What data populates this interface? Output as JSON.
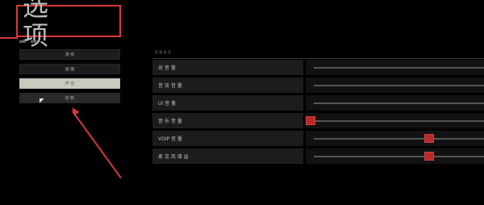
{
  "header": {
    "title": "选 项"
  },
  "menu": {
    "items": [
      {
        "label": "游 戏",
        "state": "normal"
      },
      {
        "label": "画 面",
        "state": "normal"
      },
      {
        "label": "声 音",
        "state": "selected"
      },
      {
        "label": "控 制",
        "state": "hover"
      }
    ]
  },
  "panel": {
    "header": "音 频 选 项",
    "rows": [
      {
        "label": "总 音 量",
        "value": 1.0
      },
      {
        "label": "音 效 音 量",
        "value": 1.0
      },
      {
        "label": "UI 音 量",
        "value": 1.0
      },
      {
        "label": "音 乐 音 量",
        "value": 0.0
      },
      {
        "label": "VOIP 音 量",
        "value": 0.68
      },
      {
        "label": "麦 克 风 增 益",
        "value": 0.68
      }
    ]
  },
  "colors": {
    "accent": "#d8383a",
    "thumb": "#b82a2a",
    "selected_bg": "#c9c9bd"
  }
}
